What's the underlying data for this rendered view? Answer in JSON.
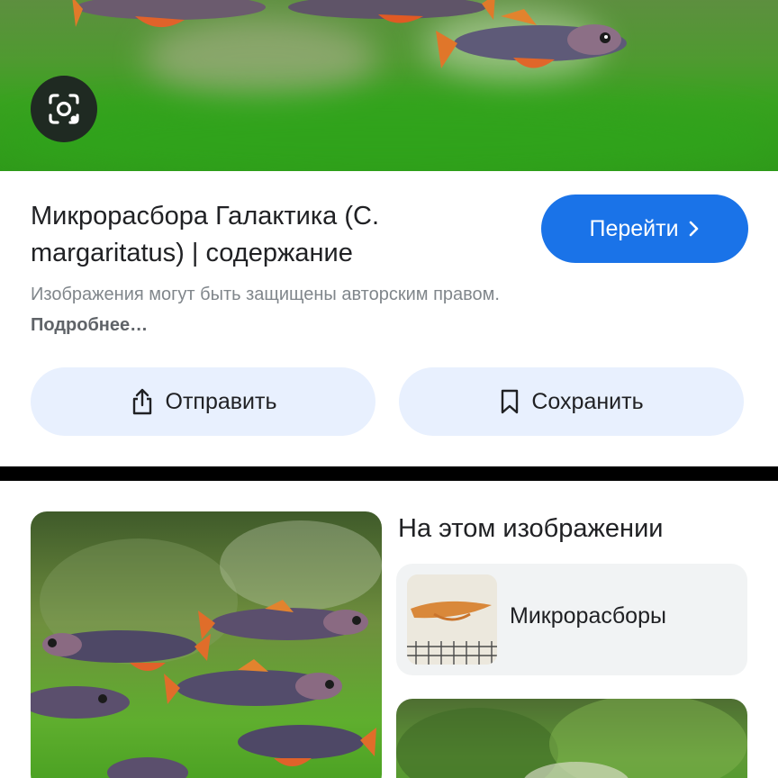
{
  "result": {
    "title": "Микрорасбора Галактика (C. margaritatus) | содержание",
    "visit_label": "Перейти",
    "notice_text": "Изображения могут быть защищены авторским правом.",
    "notice_link": "Подробнее…",
    "share_label": "Отправить",
    "save_label": "Сохранить"
  },
  "related": {
    "section_title": "На этом изображении",
    "entity_label": "Микрорасборы"
  },
  "colors": {
    "accent": "#1a73e8",
    "action_bg": "#e8f0fe",
    "card_bg": "#f1f3f4"
  }
}
